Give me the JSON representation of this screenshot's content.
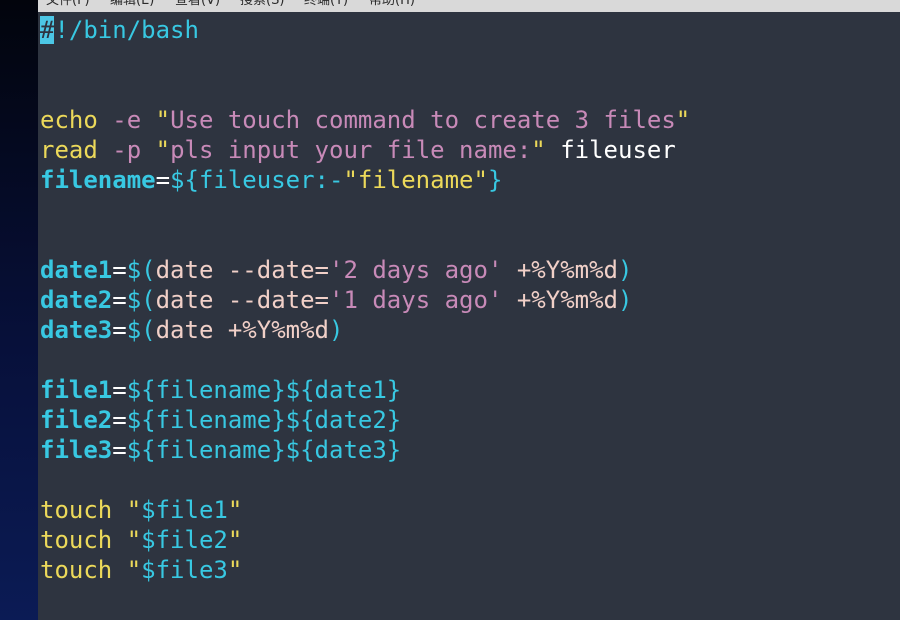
{
  "menubar": {
    "items": [
      "文件(F)",
      "编辑(E)",
      "查看(V)",
      "搜索(S)",
      "终端(T)",
      "帮助(H)"
    ]
  },
  "editor": {
    "lines": [
      [
        {
          "t": "#",
          "c": "cursor"
        },
        {
          "t": "!/bin/bash",
          "c": "par"
        }
      ],
      [],
      [],
      [
        {
          "t": "echo",
          "c": "kw"
        },
        {
          "t": " ",
          "c": "plain"
        },
        {
          "t": "-e",
          "c": "op"
        },
        {
          "t": " ",
          "c": "plain"
        },
        {
          "t": "\"",
          "c": "quote"
        },
        {
          "t": "Use touch command to create 3 files",
          "c": "str"
        },
        {
          "t": "\"",
          "c": "quote"
        }
      ],
      [
        {
          "t": "read",
          "c": "kw"
        },
        {
          "t": " ",
          "c": "plain"
        },
        {
          "t": "-p",
          "c": "op"
        },
        {
          "t": " ",
          "c": "plain"
        },
        {
          "t": "\"",
          "c": "quote"
        },
        {
          "t": "pls input your file name:",
          "c": "str"
        },
        {
          "t": "\"",
          "c": "quote"
        },
        {
          "t": " fileuser",
          "c": "plain"
        }
      ],
      [
        {
          "t": "filename",
          "c": "var"
        },
        {
          "t": "=",
          "c": "eq"
        },
        {
          "t": "${fileuser:-",
          "c": "par"
        },
        {
          "t": "\"filename\"",
          "c": "strw"
        },
        {
          "t": "}",
          "c": "par"
        }
      ],
      [],
      [],
      [
        {
          "t": "date1",
          "c": "var"
        },
        {
          "t": "=",
          "c": "eq"
        },
        {
          "t": "$(",
          "c": "par"
        },
        {
          "t": "date --date=",
          "c": "cmd"
        },
        {
          "t": "'2 days ago'",
          "c": "str"
        },
        {
          "t": " +%Y%m%d",
          "c": "cmd"
        },
        {
          "t": ")",
          "c": "par"
        }
      ],
      [
        {
          "t": "date2",
          "c": "var"
        },
        {
          "t": "=",
          "c": "eq"
        },
        {
          "t": "$(",
          "c": "par"
        },
        {
          "t": "date --date=",
          "c": "cmd"
        },
        {
          "t": "'1 days ago'",
          "c": "str"
        },
        {
          "t": " +%Y%m%d",
          "c": "cmd"
        },
        {
          "t": ")",
          "c": "par"
        }
      ],
      [
        {
          "t": "date3",
          "c": "var"
        },
        {
          "t": "=",
          "c": "eq"
        },
        {
          "t": "$(",
          "c": "par"
        },
        {
          "t": "date +%Y%m%d",
          "c": "cmd"
        },
        {
          "t": ")",
          "c": "par"
        }
      ],
      [],
      [
        {
          "t": "file1",
          "c": "var"
        },
        {
          "t": "=",
          "c": "eq"
        },
        {
          "t": "${filename}${date1}",
          "c": "par"
        }
      ],
      [
        {
          "t": "file2",
          "c": "var"
        },
        {
          "t": "=",
          "c": "eq"
        },
        {
          "t": "${filename}${date2}",
          "c": "par"
        }
      ],
      [
        {
          "t": "file3",
          "c": "var"
        },
        {
          "t": "=",
          "c": "eq"
        },
        {
          "t": "${filename}${date3}",
          "c": "par"
        }
      ],
      [],
      [
        {
          "t": "touch",
          "c": "kw"
        },
        {
          "t": " ",
          "c": "plain"
        },
        {
          "t": "\"",
          "c": "quote"
        },
        {
          "t": "$file1",
          "c": "par"
        },
        {
          "t": "\"",
          "c": "quote"
        }
      ],
      [
        {
          "t": "touch",
          "c": "kw"
        },
        {
          "t": " ",
          "c": "plain"
        },
        {
          "t": "\"",
          "c": "quote"
        },
        {
          "t": "$file2",
          "c": "par"
        },
        {
          "t": "\"",
          "c": "quote"
        }
      ],
      [
        {
          "t": "touch",
          "c": "kw"
        },
        {
          "t": " ",
          "c": "plain"
        },
        {
          "t": "\"",
          "c": "quote"
        },
        {
          "t": "$file3",
          "c": "par"
        },
        {
          "t": "\"",
          "c": "quote"
        }
      ]
    ]
  }
}
